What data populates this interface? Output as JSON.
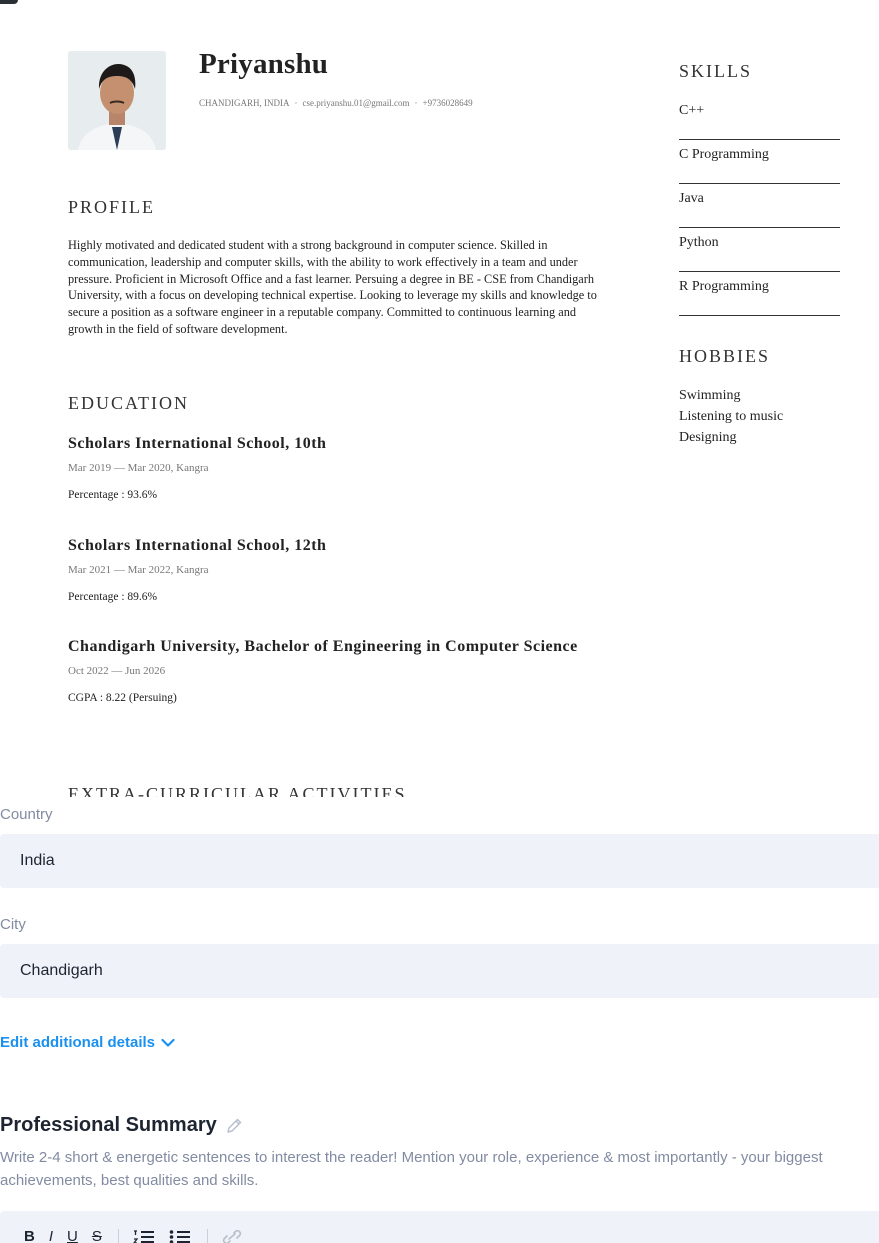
{
  "resume": {
    "name": "Priyanshu",
    "contact": {
      "location": "CHANDIGARH, INDIA",
      "email": "cse.priyanshu.01@gmail.com",
      "phone": "+9736028649",
      "separator": "·"
    },
    "profile": {
      "heading": "PROFILE",
      "text": "Highly motivated and dedicated student with a strong background in computer science. Skilled in communication, leadership and  computer skills, with the ability to work effectively in a team and under pressure. Proficient in Microsoft Office and a fast learner. Persuing a degree in BE - CSE from Chandigarh University, with a focus on developing technical expertise. Looking to leverage my skills and knowledge to secure a position as a software engineer in a reputable company. Committed to continuous learning and growth in the field of software development."
    },
    "education": {
      "heading": "EDUCATION",
      "items": [
        {
          "title": "Scholars International School, 10th",
          "date": "Mar 2019 — Mar 2020, Kangra",
          "detail": "Percentage : 93.6%"
        },
        {
          "title": "Scholars International School, 12th",
          "date": "Mar 2021 — Mar 2022, Kangra",
          "detail": "Percentage : 89.6%"
        },
        {
          "title": "Chandigarh University, Bachelor of Engineering in Computer Science",
          "date": "Oct 2022 — Jun 2026",
          "detail": "CGPA : 8.22 (Persuing)"
        }
      ]
    },
    "next_heading": "EXTRA-CURRICULAR ACTIVITIES",
    "skills": {
      "heading": "SKILLS",
      "items": [
        "C++",
        "C Programming",
        "Java",
        "Python",
        "R Programming"
      ]
    },
    "hobbies": {
      "heading": "HOBBIES",
      "items": [
        "Swimming",
        "Listening to music",
        "Designing"
      ]
    }
  },
  "form": {
    "country": {
      "label": "Country",
      "value": "India"
    },
    "city": {
      "label": "City",
      "value": "Chandigarh"
    },
    "edit_details_label": "Edit additional details",
    "summary": {
      "title": "Professional Summary",
      "hint": "Write 2-4 short & energetic sentences to interest the reader! Mention your role, experience & most importantly - your biggest achievements, best qualities and skills."
    },
    "toolbar": {
      "bold": "B",
      "italic": "I",
      "underline": "U",
      "strike": "S"
    }
  },
  "colors": {
    "accent": "#1a91f0",
    "input_bg": "#eff2f9",
    "muted_text": "#828ba2"
  },
  "icons": {
    "edit_details": "chevron-down-icon",
    "summary_title": "pencil-icon",
    "ordered_list": "ordered-list-icon",
    "bullet_list": "bullet-list-icon",
    "link": "link-icon"
  }
}
